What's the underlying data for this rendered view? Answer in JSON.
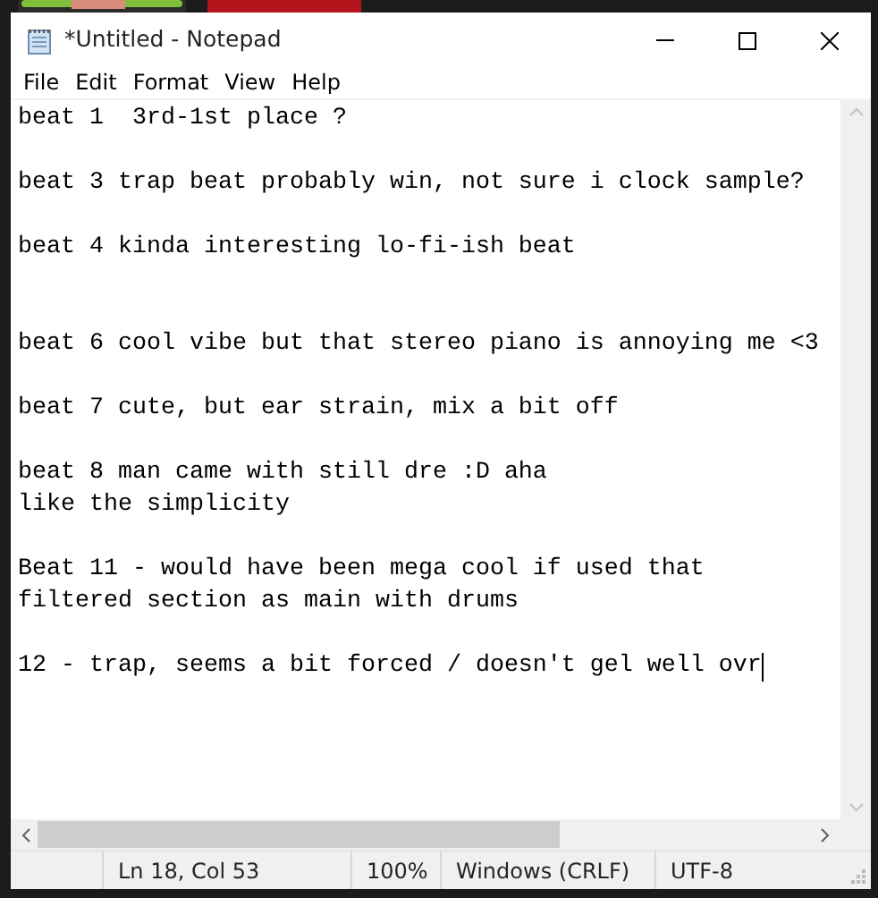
{
  "window": {
    "title": "*Untitled - Notepad"
  },
  "menu": [
    "File",
    "Edit",
    "Format",
    "View",
    "Help"
  ],
  "editor": {
    "lines": [
      {
        "kind": "text",
        "text": "beat 1  3rd-1st place ?",
        "caret": false
      },
      {
        "kind": "blank"
      },
      {
        "kind": "text",
        "text": "beat 3 trap beat probably win, not sure i clock sample?",
        "caret": false
      },
      {
        "kind": "blank"
      },
      {
        "kind": "text",
        "text": "beat 4 kinda interesting lo-fi-ish beat",
        "caret": false
      },
      {
        "kind": "blank"
      },
      {
        "kind": "blank"
      },
      {
        "kind": "text",
        "text": "beat 6 cool vibe but that stereo piano is annoying me <3",
        "caret": false
      },
      {
        "kind": "blank"
      },
      {
        "kind": "text",
        "text": "beat 7 cute, but ear strain, mix a bit off",
        "caret": false
      },
      {
        "kind": "blank"
      },
      {
        "kind": "text",
        "text": "beat 8 man came with still dre :D aha",
        "caret": false
      },
      {
        "kind": "text",
        "text": "like the simplicity",
        "caret": false
      },
      {
        "kind": "blank"
      },
      {
        "kind": "text",
        "text": "Beat 11 - would have been mega cool if used that",
        "caret": false
      },
      {
        "kind": "text",
        "text": "filtered section as main with drums",
        "caret": false
      },
      {
        "kind": "blank"
      },
      {
        "kind": "text",
        "text": "12 - trap, seems a bit forced / doesn't gel well ovr",
        "caret": true
      }
    ]
  },
  "status_bar": [
    "Ln 18, Col 53",
    "100%",
    "Windows (CRLF)",
    "UTF-8"
  ]
}
